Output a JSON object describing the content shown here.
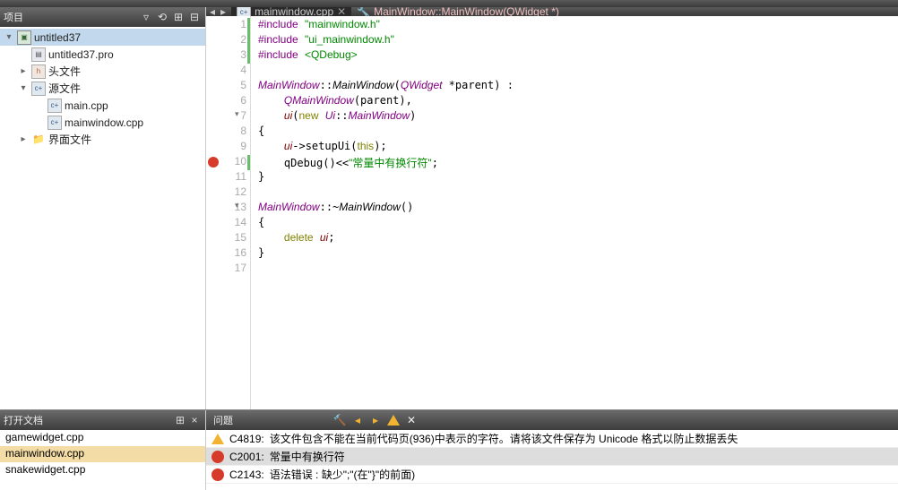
{
  "sidebar": {
    "title": "项目",
    "items": [
      {
        "label": "untitled37",
        "icon": "proj",
        "arrow": "▾",
        "indent": 0,
        "active": true
      },
      {
        "label": "untitled37.pro",
        "icon": "pro",
        "arrow": "",
        "indent": 1
      },
      {
        "label": "头文件",
        "icon": "h",
        "arrow": "▸",
        "indent": 1
      },
      {
        "label": "源文件",
        "icon": "cpp",
        "arrow": "▾",
        "indent": 1
      },
      {
        "label": "main.cpp",
        "icon": "cpp",
        "arrow": "",
        "indent": 2
      },
      {
        "label": "mainwindow.cpp",
        "icon": "cpp",
        "arrow": "",
        "indent": 2
      },
      {
        "label": "界面文件",
        "icon": "folder",
        "arrow": "▸",
        "indent": 1
      }
    ]
  },
  "tabs": {
    "file": "mainwindow.cpp",
    "breadcrumb": "MainWindow::MainWindow(QWidget *)"
  },
  "code": {
    "lines": [
      {
        "n": 1,
        "green": true,
        "html": "<span class='pp'>#include</span> <span class='ppinc'>\"mainwindow.h\"</span>"
      },
      {
        "n": 2,
        "green": true,
        "html": "<span class='pp'>#include</span> <span class='ppinc'>\"ui_mainwindow.h\"</span>"
      },
      {
        "n": 3,
        "green": true,
        "html": "<span class='pp'>#include</span> <span class='ppinc'>&lt;QDebug&gt;</span>"
      },
      {
        "n": 4,
        "html": ""
      },
      {
        "n": 5,
        "html": "<span class='type'>MainWindow</span>::<span class='it'>MainWindow</span>(<span class='type'>QWidget</span> *parent) :"
      },
      {
        "n": 6,
        "html": "    <span class='type'>QMainWindow</span>(parent),"
      },
      {
        "n": 7,
        "fold": "▾",
        "html": "    <span class='id'>ui</span>(<span class='kw'>new</span> <span class='type'>Ui</span>::<span class='type'>MainWindow</span>)"
      },
      {
        "n": 8,
        "html": "{"
      },
      {
        "n": 9,
        "html": "    <span class='id'>ui</span>-&gt;setupUi(<span class='kw'>this</span>);"
      },
      {
        "n": 10,
        "err": true,
        "green": true,
        "html": "    qDebug()&lt;&lt;<span class='str'>\"常量中有换行符\"</span>;"
      },
      {
        "n": 11,
        "html": "}"
      },
      {
        "n": 12,
        "html": ""
      },
      {
        "n": 13,
        "fold": "▾",
        "html": "<span class='type'>MainWindow</span>::~<span class='it'>MainWindow</span>()"
      },
      {
        "n": 14,
        "html": "{"
      },
      {
        "n": 15,
        "html": "    <span class='kw'>delete</span> <span class='id'>ui</span>;"
      },
      {
        "n": 16,
        "html": "}"
      },
      {
        "n": 17,
        "html": ""
      }
    ]
  },
  "opendocs": {
    "title": "打开文档",
    "items": [
      {
        "label": "gamewidget.cpp"
      },
      {
        "label": "mainwindow.cpp",
        "sel": true
      },
      {
        "label": "snakewidget.cpp"
      }
    ]
  },
  "problems": {
    "title": "问题",
    "items": [
      {
        "sev": "warn",
        "code": "C4819:",
        "msg": "该文件包含不能在当前代码页(936)中表示的字符。请将该文件保存为 Unicode 格式以防止数据丢失"
      },
      {
        "sev": "err",
        "code": "C2001:",
        "msg": "常量中有换行符",
        "sel": true
      },
      {
        "sev": "err",
        "code": "C2143:",
        "msg": "语法错误 : 缺少\";\"(在\"}\"的前面)"
      }
    ]
  }
}
